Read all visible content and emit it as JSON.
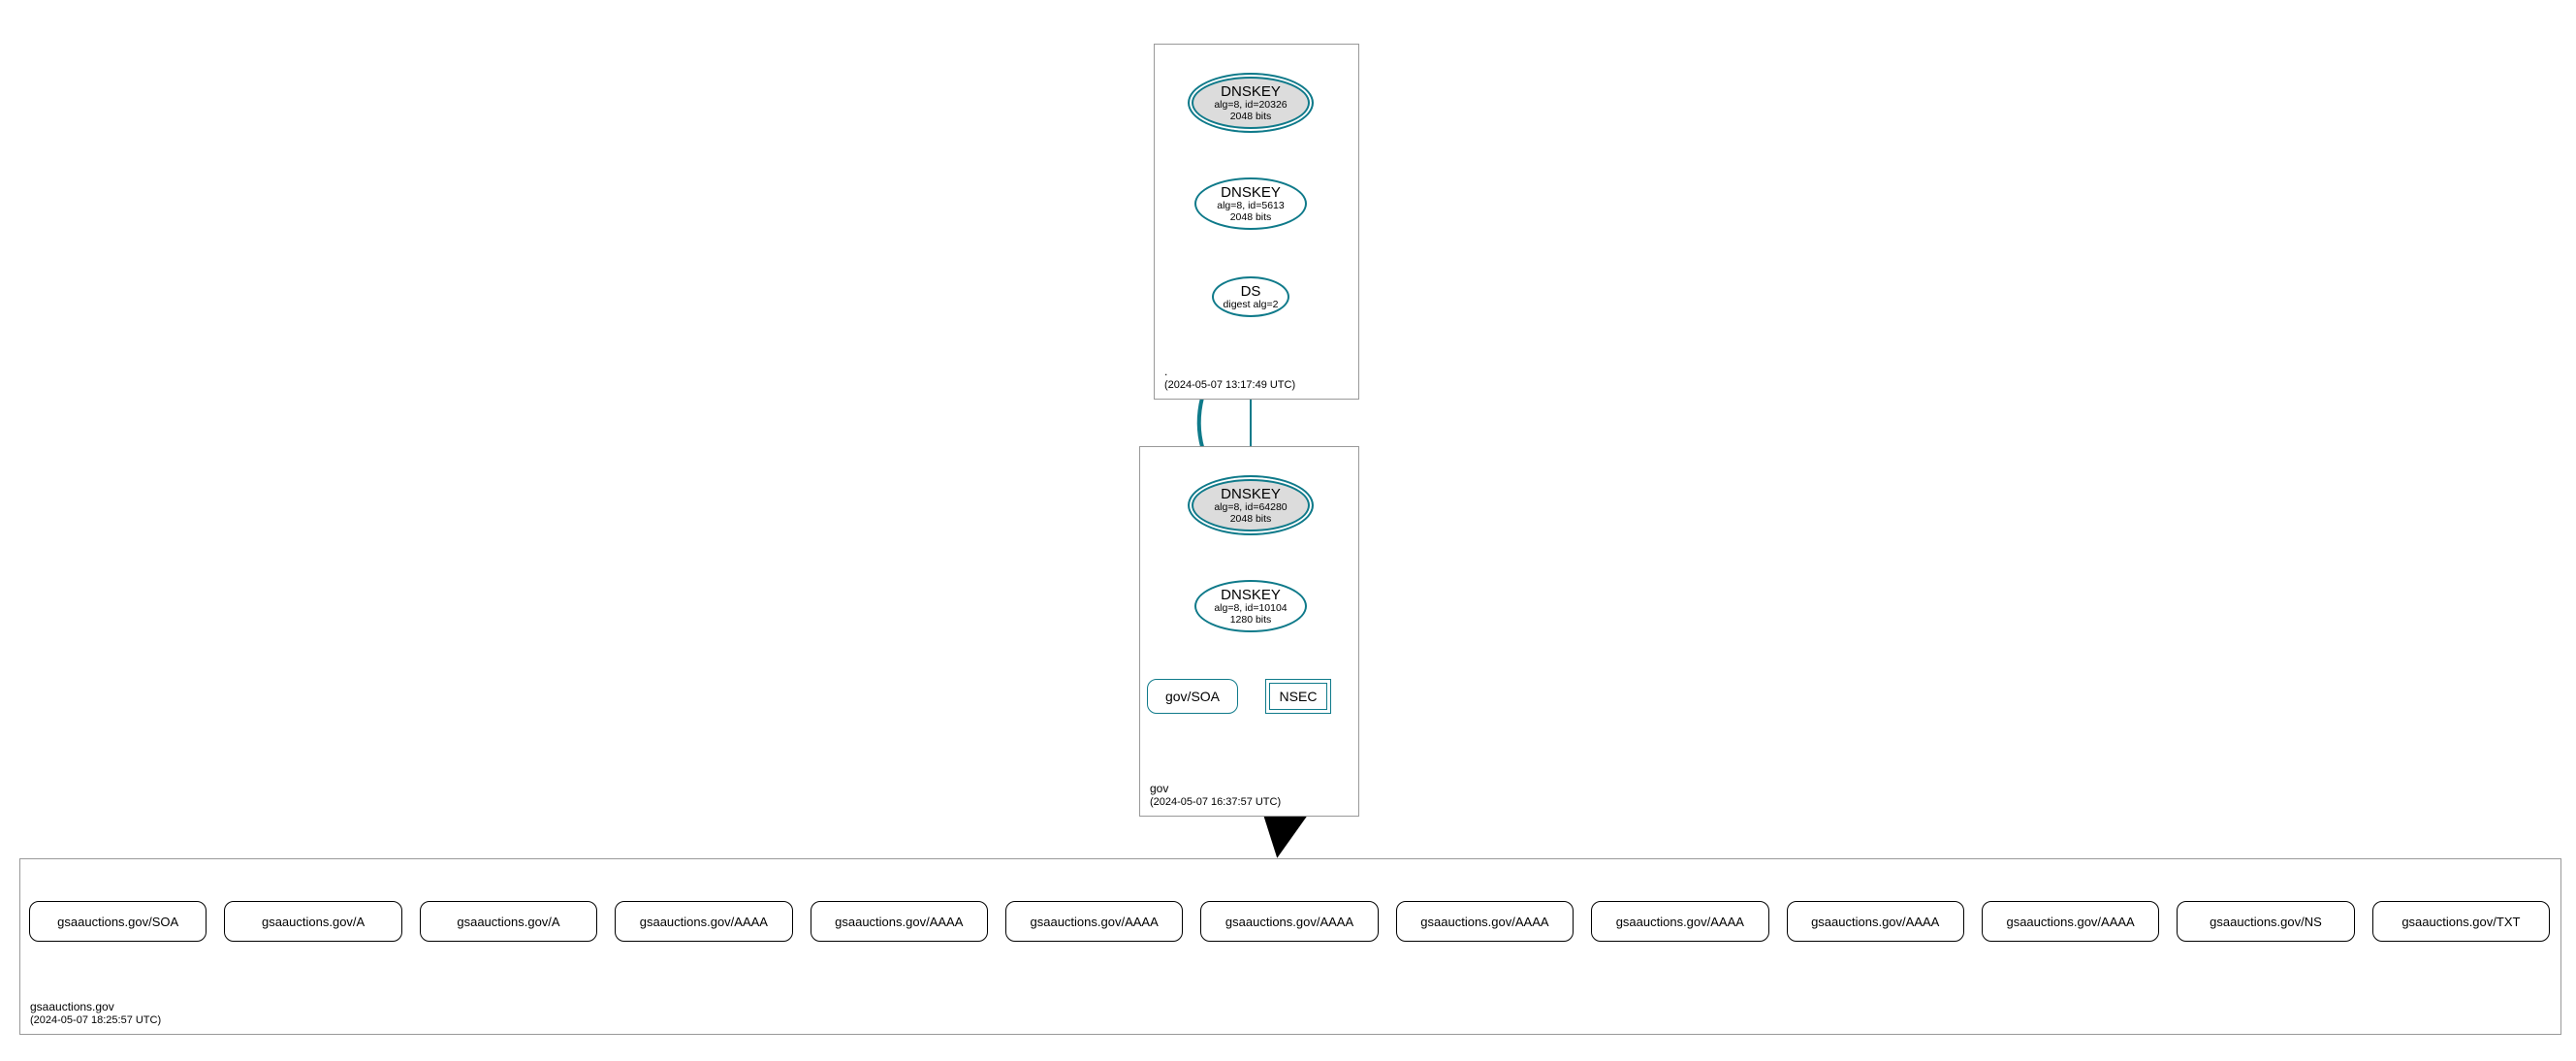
{
  "colors": {
    "teal": "#0f7a8a",
    "gray_fill": "#dcdcdc",
    "black": "#000000"
  },
  "zones": {
    "root": {
      "name": ".",
      "timestamp": "(2024-05-07 13:17:49 UTC)"
    },
    "gov": {
      "name": "gov",
      "timestamp": "(2024-05-07 16:37:57 UTC)"
    },
    "leaf": {
      "name": "gsaauctions.gov",
      "timestamp": "(2024-05-07 18:25:57 UTC)"
    }
  },
  "nodes": {
    "root_ksk": {
      "title": "DNSKEY",
      "sub": "alg=8, id=20326",
      "sub2": "2048 bits"
    },
    "root_zsk": {
      "title": "DNSKEY",
      "sub": "alg=8, id=5613",
      "sub2": "2048 bits"
    },
    "root_ds": {
      "title": "DS",
      "sub": "digest alg=2"
    },
    "gov_ksk": {
      "title": "DNSKEY",
      "sub": "alg=8, id=64280",
      "sub2": "2048 bits"
    },
    "gov_zsk": {
      "title": "DNSKEY",
      "sub": "alg=8, id=10104",
      "sub2": "1280 bits"
    },
    "gov_soa": {
      "title": "gov/SOA"
    },
    "gov_nsec": {
      "title": "NSEC"
    }
  },
  "leaf_rrsets": [
    "gsaauctions.gov/SOA",
    "gsaauctions.gov/A",
    "gsaauctions.gov/A",
    "gsaauctions.gov/AAAA",
    "gsaauctions.gov/AAAA",
    "gsaauctions.gov/AAAA",
    "gsaauctions.gov/AAAA",
    "gsaauctions.gov/AAAA",
    "gsaauctions.gov/AAAA",
    "gsaauctions.gov/AAAA",
    "gsaauctions.gov/AAAA",
    "gsaauctions.gov/NS",
    "gsaauctions.gov/TXT"
  ]
}
